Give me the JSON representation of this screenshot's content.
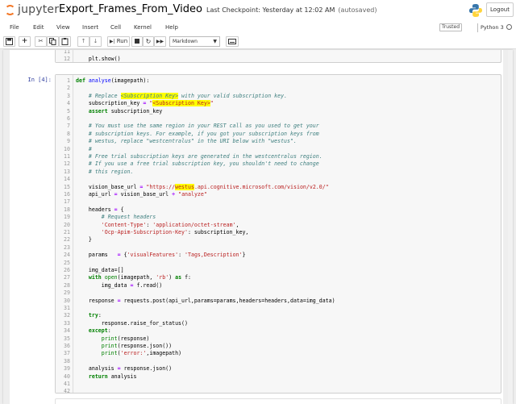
{
  "header": {
    "logo_text": "jupyter",
    "notebook_name": "Export_Frames_From_Video",
    "checkpoint": "Last Checkpoint: Yesterday at 12:02 AM",
    "autosaved": "(autosaved)",
    "logout_label": "Logout"
  },
  "menubar": {
    "items": [
      "File",
      "Edit",
      "View",
      "Insert",
      "Cell",
      "Kernel",
      "Help"
    ],
    "trusted_label": "Trusted",
    "kernel_name": "Python 3"
  },
  "toolbar": {
    "run_label": "Run",
    "cell_type": "Markdown"
  },
  "prev_cell": {
    "lines": [
      {
        "n": "11",
        "t": ""
      },
      {
        "n": "12",
        "t": "plt.show()"
      }
    ]
  },
  "cell": {
    "prompt": "In [4]:",
    "lines": [
      {
        "n": "1",
        "t": "def analyse(imagepath):"
      },
      {
        "n": "2",
        "t": ""
      },
      {
        "n": "3",
        "t": "    # Replace <Subscription Key> with your valid subscription key."
      },
      {
        "n": "4",
        "t": "    subscription_key = \"<Subscription Key>\""
      },
      {
        "n": "5",
        "t": "    assert subscription_key"
      },
      {
        "n": "6",
        "t": ""
      },
      {
        "n": "7",
        "t": "    # You must use the same region in your REST call as you used to get your"
      },
      {
        "n": "8",
        "t": "    # subscription keys. For example, if you got your subscription keys from"
      },
      {
        "n": "9",
        "t": "    # westus, replace \"westcentralus\" in the URI below with \"westus\"."
      },
      {
        "n": "10",
        "t": "    #"
      },
      {
        "n": "11",
        "t": "    # Free trial subscription keys are generated in the westcentralus region."
      },
      {
        "n": "12",
        "t": "    # If you use a free trial subscription key, you shouldn't need to change"
      },
      {
        "n": "13",
        "t": "    # this region."
      },
      {
        "n": "14",
        "t": ""
      },
      {
        "n": "15",
        "t": "    vision_base_url = \"https://westus.api.cognitive.microsoft.com/vision/v2.0/\""
      },
      {
        "n": "16",
        "t": "    api_url = vision_base_url + \"analyze\""
      },
      {
        "n": "17",
        "t": ""
      },
      {
        "n": "18",
        "t": "    headers = {"
      },
      {
        "n": "19",
        "t": "        # Request headers"
      },
      {
        "n": "20",
        "t": "        'Content-Type': 'application/octet-stream',"
      },
      {
        "n": "21",
        "t": "        'Ocp-Apim-Subscription-Key': subscription_key,"
      },
      {
        "n": "22",
        "t": "    }"
      },
      {
        "n": "23",
        "t": ""
      },
      {
        "n": "24",
        "t": "    params   = {'visualFeatures': 'Tags,Description'}"
      },
      {
        "n": "25",
        "t": ""
      },
      {
        "n": "26",
        "t": "    img_data=[]"
      },
      {
        "n": "27",
        "t": "    with open(imagepath, 'rb') as f:"
      },
      {
        "n": "28",
        "t": "        img_data = f.read()"
      },
      {
        "n": "29",
        "t": ""
      },
      {
        "n": "30",
        "t": "    response = requests.post(api_url,params=params,headers=headers,data=img_data)"
      },
      {
        "n": "31",
        "t": ""
      },
      {
        "n": "32",
        "t": "    try:"
      },
      {
        "n": "33",
        "t": "        response.raise_for_status()"
      },
      {
        "n": "34",
        "t": "    except:"
      },
      {
        "n": "35",
        "t": "        print(response)"
      },
      {
        "n": "36",
        "t": "        print(response.json())"
      },
      {
        "n": "37",
        "t": "        print('error:',imagepath)"
      },
      {
        "n": "38",
        "t": ""
      },
      {
        "n": "39",
        "t": "    analysis = response.json()"
      },
      {
        "n": "40",
        "t": "    return analysis"
      },
      {
        "n": "41",
        "t": ""
      },
      {
        "n": "42",
        "t": ""
      }
    ]
  },
  "icons": {
    "python_logo": "python-logo-icon",
    "save": "save-icon",
    "add": "plus-icon",
    "cut": "scissors-icon",
    "copy": "copy-icon",
    "paste": "paste-icon",
    "up": "arrow-up-icon",
    "down": "arrow-down-icon",
    "run": "play-icon",
    "stop": "stop-icon",
    "restart": "restart-icon",
    "restart_run": "fast-forward-icon",
    "keyboard": "keyboard-icon"
  },
  "colors": {
    "accent_orange": "#f37726",
    "prompt_blue": "#303f9f",
    "highlight": "#ffff00"
  }
}
